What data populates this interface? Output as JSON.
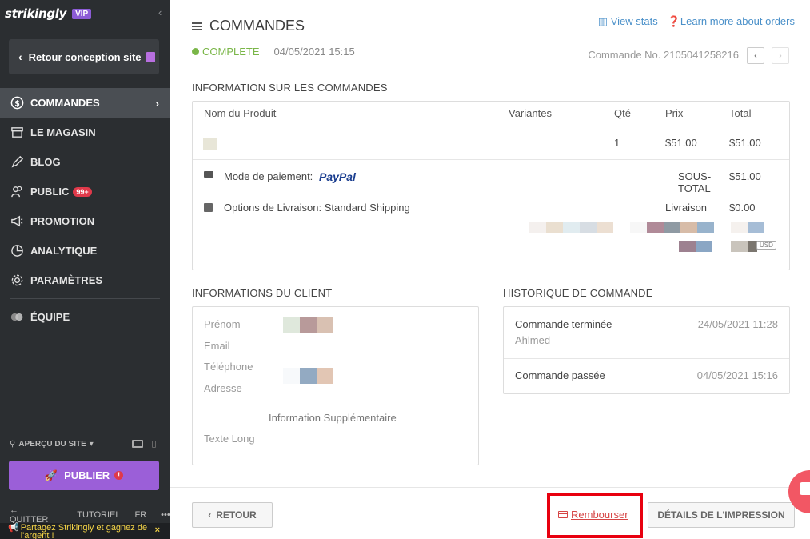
{
  "sidebar": {
    "logo": "strikingly",
    "vip": "VIP",
    "back_label": "Retour conception site",
    "nav": [
      {
        "label": "COMMANDES",
        "icon": "dollar-circle-icon"
      },
      {
        "label": "LE MAGASIN",
        "icon": "store-icon"
      },
      {
        "label": "BLOG",
        "icon": "pen-icon"
      },
      {
        "label": "PUBLIC",
        "icon": "people-icon",
        "badge": "99+"
      },
      {
        "label": "PROMOTION",
        "icon": "megaphone-icon"
      },
      {
        "label": "ANALYTIQUE",
        "icon": "pie-chart-icon"
      },
      {
        "label": "PARAMÈTRES",
        "icon": "gear-icon"
      },
      {
        "label": "ÉQUIPE",
        "icon": "team-icon"
      }
    ],
    "preview": "APERÇU DU SITE",
    "publish": "PUBLIER",
    "quit": "QUITTER",
    "tutorial": "TUTORIEL",
    "lang": "FR",
    "more": "•••",
    "share": "Partagez Strikingly et gagnez de l'argent !",
    "share_close": "×"
  },
  "header": {
    "title": "COMMANDES",
    "view_stats": "View stats",
    "learn_more": "Learn more about orders",
    "status": "COMPLETE",
    "date": "04/05/2021 15:15",
    "order_no": "Commande No. 2105041258216"
  },
  "orders": {
    "title": "INFORMATION SUR LES COMMANDES",
    "columns": [
      "Nom du Produit",
      "Variantes",
      "Qté",
      "Prix",
      "Total"
    ],
    "row": {
      "qty": "1",
      "price": "$51.00",
      "total": "$51.00"
    },
    "payment_label": "Mode de paiement:",
    "payment_brand": "PayPal",
    "subtotal_label_1": "SOUS-",
    "subtotal_label_2": "TOTAL",
    "subtotal_value": "$51.00",
    "shipping_label": "Options de Livraison: Standard Shipping",
    "shipping_right_label": "Livraison",
    "shipping_value": "$0.00",
    "currency": "USD"
  },
  "client": {
    "title": "INFORMATIONS DU CLIENT",
    "firstname": "Prénom",
    "email": "Email",
    "phone": "Téléphone",
    "address": "Adresse",
    "extra": "Information Supplémentaire",
    "long_text": "Texte Long"
  },
  "history": {
    "title": "HISTORIQUE DE COMMANDE",
    "items": [
      {
        "label": "Commande terminée",
        "user": "Ahlmed",
        "date": "24/05/2021 11:28"
      },
      {
        "label": "Commande passée",
        "user": "",
        "date": "04/05/2021 15:16"
      }
    ]
  },
  "footer": {
    "back": "RETOUR",
    "refund": "Rembourser",
    "print": "DÉTAILS DE L'IMPRESSION"
  }
}
